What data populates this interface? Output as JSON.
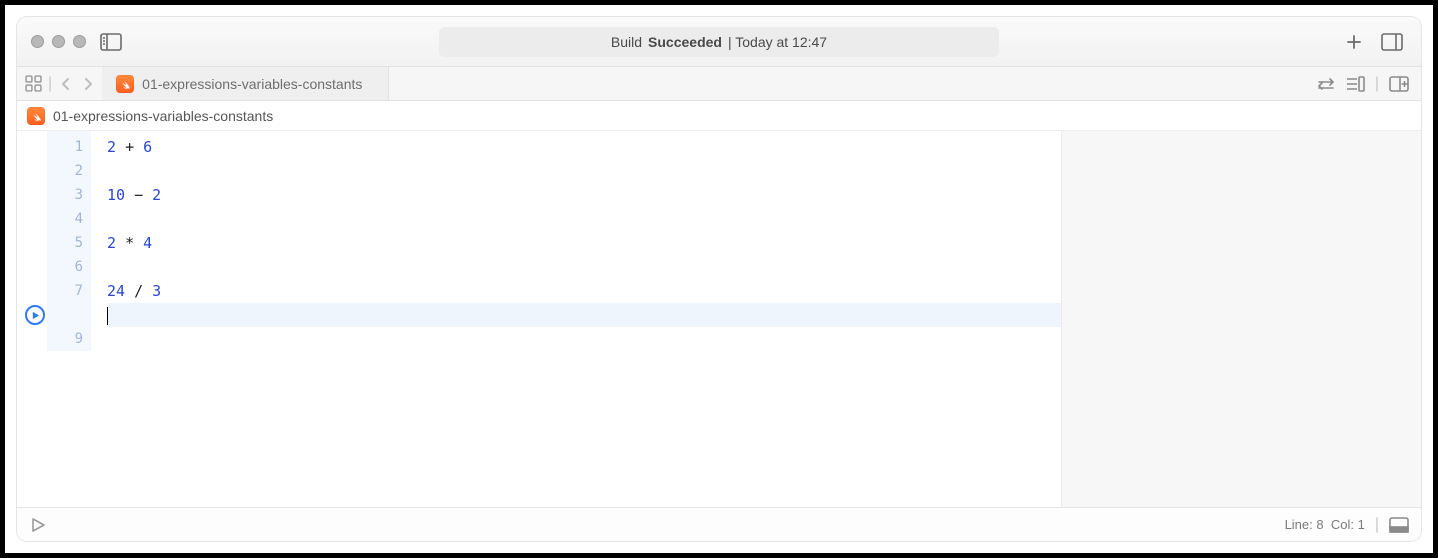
{
  "window": {
    "status_prefix": "Build",
    "status_bold": "Succeeded",
    "status_suffix": "| Today at 12:47"
  },
  "tab": {
    "label": "01-expressions-variables-constants"
  },
  "breadcrumb": {
    "label": "01-expressions-variables-constants"
  },
  "editor": {
    "lines": [
      {
        "n": "1",
        "kind": "expr",
        "a": "2",
        "op": "+",
        "b": "6"
      },
      {
        "n": "2",
        "kind": "blank"
      },
      {
        "n": "3",
        "kind": "expr",
        "a": "10",
        "op": "−",
        "b": "2"
      },
      {
        "n": "4",
        "kind": "blank"
      },
      {
        "n": "5",
        "kind": "expr",
        "a": "2",
        "op": "*",
        "b": "4"
      },
      {
        "n": "6",
        "kind": "blank"
      },
      {
        "n": "7",
        "kind": "expr",
        "a": "24",
        "op": "/",
        "b": "3"
      },
      {
        "n": "",
        "kind": "cursor"
      },
      {
        "n": "9",
        "kind": "blank"
      }
    ]
  },
  "status_bar": {
    "line_label": "Line:",
    "line": "8",
    "col_label": "Col:",
    "col": "1"
  }
}
